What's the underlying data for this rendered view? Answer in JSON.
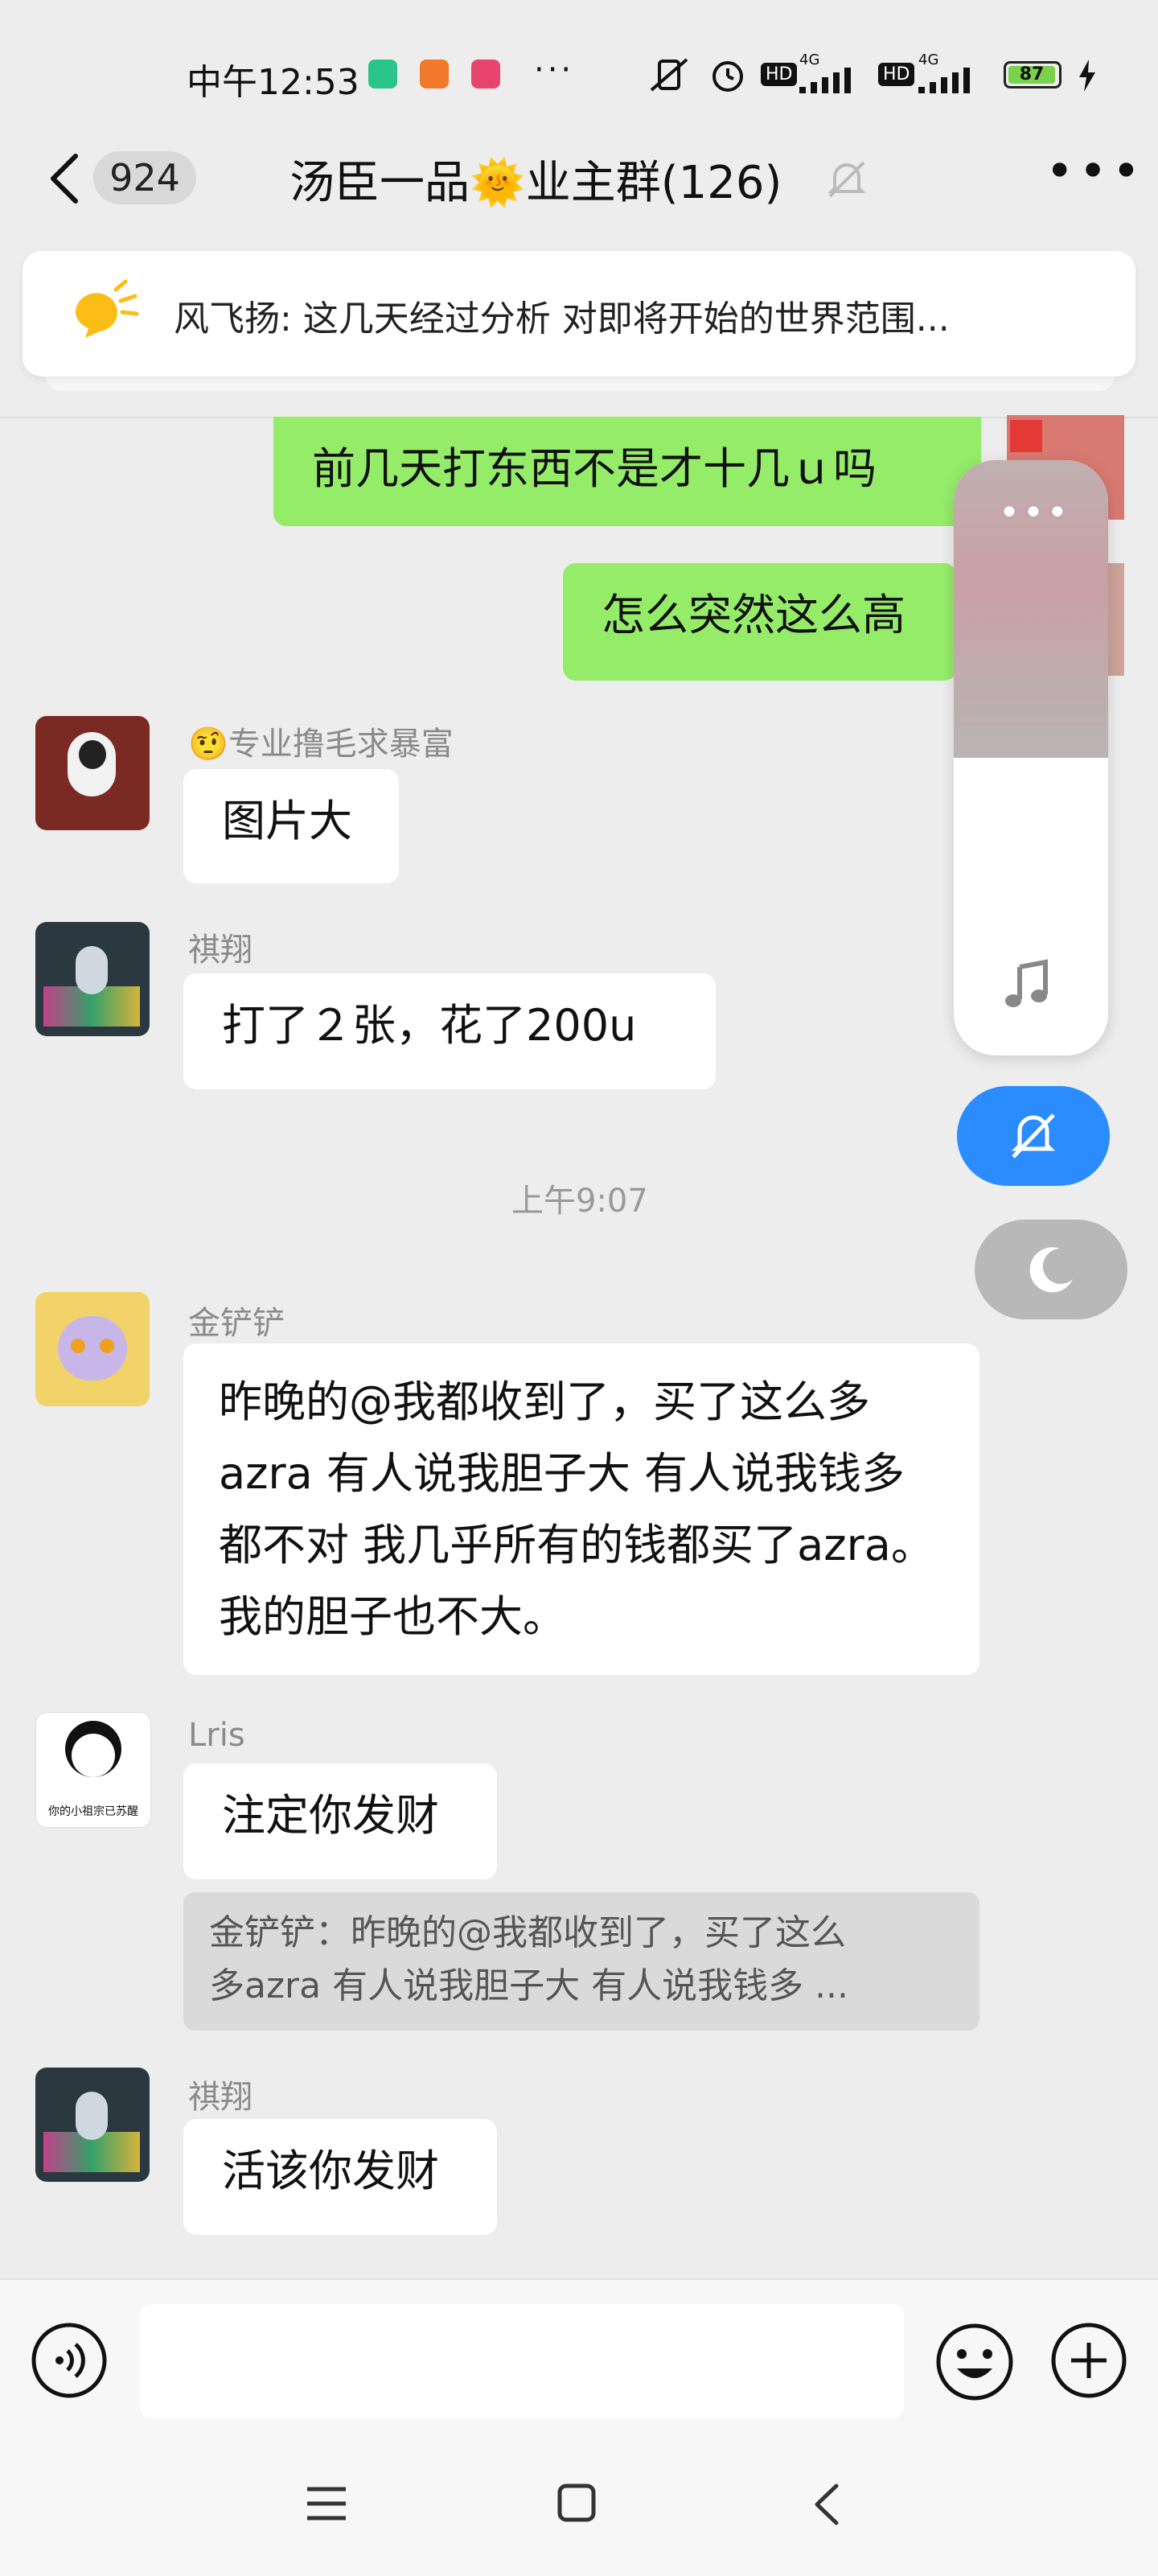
{
  "status_bar": {
    "time": "中午12:53",
    "more": "···",
    "net1": "HD",
    "sig1": "4G",
    "net2": "HD",
    "sig2": "4G",
    "battery": "87"
  },
  "header": {
    "unread_count": "924",
    "title": "汤臣一品🌞业主群(126)"
  },
  "announcement": {
    "text": "风飞扬: 这几天经过分析 对即将开始的世界范围..."
  },
  "colors": {
    "self_bubble": "#95ec69",
    "other_bubble": "#ffffff",
    "accent_blue": "#2b8cff"
  },
  "messages": [
    {
      "side": "right",
      "text": "前几天打东西不是才十几ｕ吗"
    },
    {
      "side": "right",
      "text": "怎么突然这么高"
    },
    {
      "side": "left",
      "sender": "🤨专业撸毛求暴富",
      "text": "图片大"
    },
    {
      "side": "left",
      "sender": "祺翔",
      "text": "打了２张，花了200u"
    },
    {
      "side": "left",
      "sender": "金铲铲",
      "text": "昨晚的@我都收到了，买了这么多azra  有人说我胆子大  有人说我钱多  都不对  我几乎所有的钱都买了azra。我的胆子也不大。"
    },
    {
      "side": "left",
      "sender": "Lris",
      "text": "注定你发财"
    },
    {
      "side": "left",
      "sender": "祺翔",
      "text": "活该你发财"
    }
  ],
  "time_separator": "上午9:07",
  "quote": {
    "line1": "金铲铲：昨晚的@我都收到了，买了这么",
    "line2": "多azra  有人说我胆子大  有人说我钱多 ..."
  },
  "avatar_captions": {
    "lris": "你的小祖宗已苏醒"
  }
}
